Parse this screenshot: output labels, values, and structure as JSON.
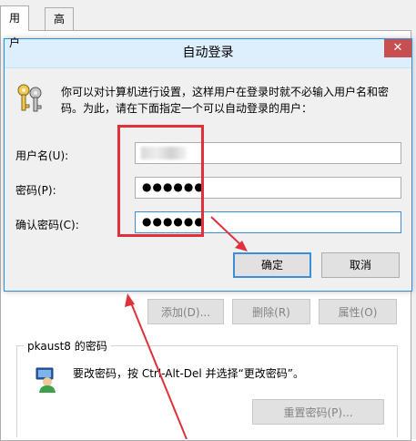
{
  "background_window": {
    "tabs": [
      "用户",
      "高级"
    ],
    "buttons": {
      "add": "添加(D)...",
      "remove": "删除(R)",
      "properties": "属性(O)"
    },
    "password_group": {
      "title": "pkaust8 的密码",
      "text": "要改密码，按 Ctrl-Alt-Del 并选择“更改密码”。",
      "reset_button": "重置密码(P)..."
    }
  },
  "dialog": {
    "title": "自动登录",
    "close_glyph": "✕",
    "description": "你可以对计算机进行设置，这样用户在登录时就不必输入用户名和密码。为此，请在下面指定一个可以自动登录的用户：",
    "fields": {
      "username_label": "用户名(U):",
      "password_label": "密码(P):",
      "password_mask": "●●●●●●",
      "confirm_label": "确认密码(C):",
      "confirm_mask": "●●●●●●"
    },
    "buttons": {
      "ok": "确定",
      "cancel": "取消"
    }
  },
  "annotation": {
    "color": "#e0303a"
  },
  "colors": {
    "accent": "#3c8fd6",
    "close": "#c74f4f"
  },
  "icons": [
    "keys-icon",
    "user-icon",
    "close-icon"
  ]
}
